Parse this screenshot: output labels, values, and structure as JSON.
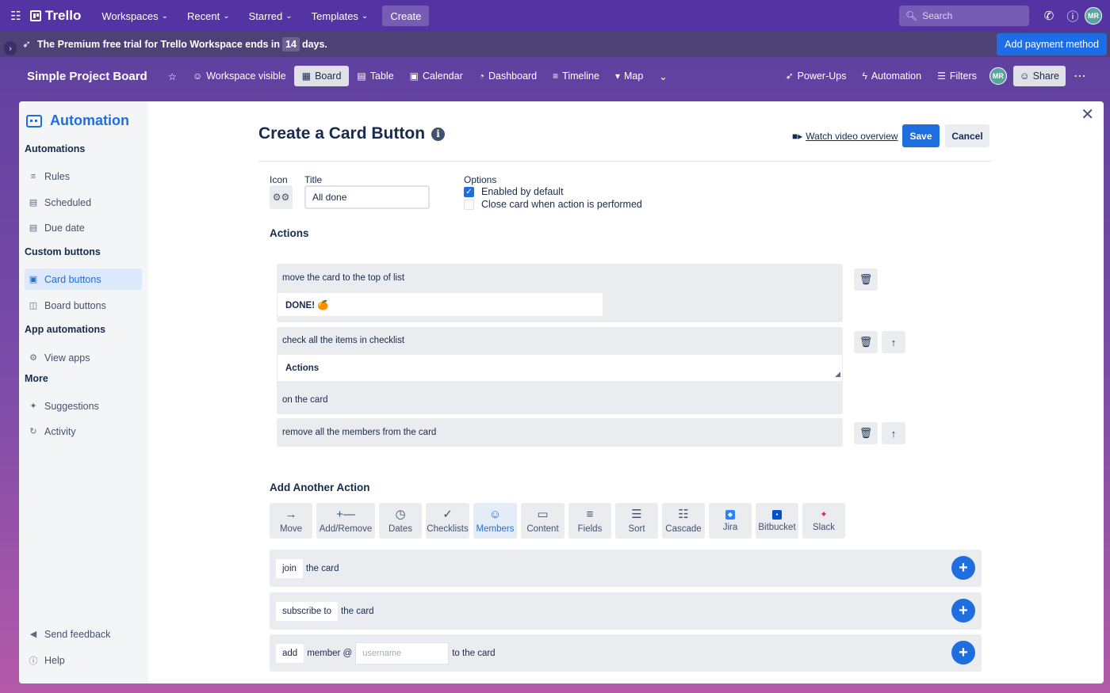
{
  "topnav": {
    "app_name": "Trello",
    "items": [
      {
        "label": "Workspaces"
      },
      {
        "label": "Recent"
      },
      {
        "label": "Starred"
      },
      {
        "label": "Templates"
      }
    ],
    "create_label": "Create",
    "search_placeholder": "Search",
    "avatar_initials": "MR"
  },
  "banner": {
    "text_before": "The Premium free trial for Trello Workspace ends in",
    "days": "14",
    "text_after": "days.",
    "pay_label": "Add payment method"
  },
  "boardbar": {
    "title": "Simple Project Board",
    "visibility": "Workspace visible",
    "views": [
      "Board",
      "Table",
      "Calendar",
      "Dashboard",
      "Timeline",
      "Map"
    ],
    "powerups": "Power-Ups",
    "automation": "Automation",
    "filters": "Filters",
    "avatar_initials": "MR",
    "share": "Share"
  },
  "sidebar": {
    "title": "Automation",
    "sec_automations": "Automations",
    "rules": "Rules",
    "scheduled": "Scheduled",
    "due_date": "Due date",
    "sec_custom": "Custom buttons",
    "card_buttons": "Card buttons",
    "board_buttons": "Board buttons",
    "sec_app": "App automations",
    "view_apps": "View apps",
    "sec_more": "More",
    "suggestions": "Suggestions",
    "activity": "Activity",
    "send_feedback": "Send feedback",
    "help": "Help"
  },
  "main": {
    "title": "Create a Card Button",
    "video_link": "Watch video overview",
    "save": "Save",
    "cancel": "Cancel",
    "icon_label": "Icon",
    "title_label": "Title",
    "title_value": "All done",
    "options_label": "Options",
    "opt_enabled": "Enabled by default",
    "opt_close": "Close card when action is performed",
    "actions_heading": "Actions",
    "actions": {
      "a1_text": "move the card to the top of list",
      "a1_field": "DONE! 🍊",
      "a2_text": "check all the items in checklist",
      "a2_field": "Actions",
      "a2_suffix": "on the card",
      "a3_text": "remove all the members from the card"
    },
    "add_heading": "Add Another Action",
    "tiles": [
      "Move",
      "Add/Remove",
      "Dates",
      "Checklists",
      "Members",
      "Content",
      "Fields",
      "Sort",
      "Cascade",
      "Jira",
      "Bitbucket",
      "Slack"
    ],
    "rows": {
      "r1_chip": "join",
      "r1_text": "the card",
      "r2_chip": "subscribe to",
      "r2_text": "the card",
      "r3_chip": "add",
      "r3_mid": "member @",
      "r3_placeholder": "username",
      "r3_text": "to the card"
    }
  },
  "colors": {
    "accent": "#1f6ee0",
    "nav": "#5434a3",
    "banner": "#4d4275"
  }
}
